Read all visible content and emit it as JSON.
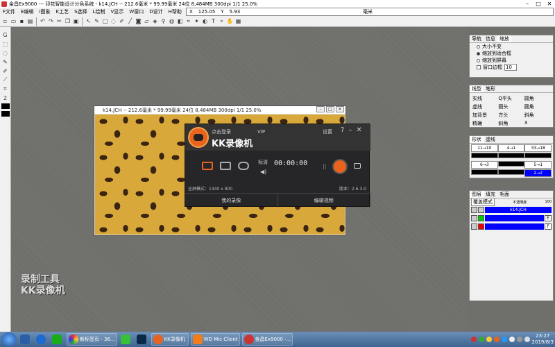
{
  "app": {
    "title": "金昌Ex9000 --- 印花智能设计分色系统 - k14.JCH -- 212.6毫米 * 99.99毫米 24位 8,484MB 300dpi 1/1 25.0%"
  },
  "menu": [
    "F文件",
    "E编辑",
    "I图象",
    "K工艺",
    "S选择",
    "L绘制",
    "V显示",
    "W窗口",
    "D设计",
    "H帮助"
  ],
  "coords": {
    "x_label": "X",
    "x": "125.05",
    "y_label": "Y",
    "y": "5.93",
    "unit": "毫米"
  },
  "left_tools": {
    "size": "2"
  },
  "doc": {
    "title": "k14.JCH -- 212.6毫米 * 99.99毫米 24位 8,484MB 300dpi 1/1 25.0%"
  },
  "kk": {
    "login": "点击登录",
    "vip": "VIP",
    "settings": "设置",
    "help": "?",
    "minimize": "–",
    "close": "✕",
    "name": "KK录像机",
    "mode_label": "标清",
    "time": "00:00:00",
    "pause": "||",
    "status": "全屏模式：1440 x 900",
    "version": "版本：2.6.3.0",
    "my_recordings": "我的录像",
    "edit_video": "编辑视频"
  },
  "watermark": {
    "line1": "录制工具",
    "line2": "KK录像机"
  },
  "nav_panel": {
    "tabs": [
      "导航",
      "信息",
      "缩放"
    ],
    "options": [
      {
        "label": "大小不变",
        "checked": false
      },
      {
        "label": "缩放到适合框",
        "checked": true
      },
      {
        "label": "缩放到屏幕",
        "checked": false
      }
    ],
    "border_label": "窗口边框",
    "border_value": "10"
  },
  "line_panel": {
    "tabs": [
      "线型",
      "笔形"
    ],
    "options": [
      "实线",
      "Q平头",
      "圆角",
      "虚线",
      "圆头",
      "圆角",
      "加背景",
      "方头",
      "斜角",
      "精确",
      "斜角"
    ],
    "value": "3"
  },
  "shape_panel": {
    "tabs": [
      "形状",
      "虚线"
    ],
    "rows": [
      [
        "11→10",
        "4→1",
        "33→18"
      ],
      [
        "",
        "",
        ""
      ],
      [
        "6→3",
        "",
        "5→1"
      ],
      [
        "",
        "",
        "2→2"
      ]
    ]
  },
  "layer_panel": {
    "tabs": [
      "图层",
      "填充",
      "毛面"
    ],
    "mode": "覆盖模式",
    "label": "不透明度",
    "pct": "100",
    "layers": [
      {
        "name": "k14.JCH",
        "color": "#0000ff",
        "num": ""
      },
      {
        "name": "",
        "color": "#00cc00",
        "num": "E"
      },
      {
        "name": "",
        "color": "#ee0000",
        "num": "F"
      }
    ]
  },
  "taskbar": {
    "items": [
      "",
      "",
      "",
      "新标签页 - 36...",
      "",
      "",
      "KK录像机",
      "WO Mic Client",
      "金昌Ex9000 -..."
    ],
    "time": "23:27",
    "date": "2019/8/3"
  },
  "colors": {
    "accent": "#e8641e",
    "titlebar": "#ffffff",
    "panel": "#f0f0f0",
    "layer_blue": "#0000ff"
  }
}
